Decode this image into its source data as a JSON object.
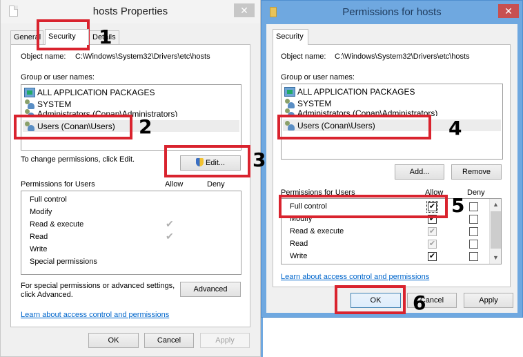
{
  "properties_window": {
    "title": "hosts Properties",
    "close_label": "✕",
    "tabs": [
      {
        "label": "General",
        "active": false
      },
      {
        "label": "Security",
        "active": true
      },
      {
        "label": "Details",
        "active": false
      }
    ],
    "object_name_label": "Object name:",
    "object_name_value": "C:\\Windows\\System32\\Drivers\\etc\\hosts",
    "group_label": "Group or user names:",
    "groups": [
      {
        "name": "ALL APPLICATION PACKAGES",
        "icon": "package-icon",
        "selected": false
      },
      {
        "name": "SYSTEM",
        "icon": "users-icon",
        "selected": false
      },
      {
        "name": "Administrators (Conan\\Administrators)",
        "icon": "users-icon",
        "selected": false
      },
      {
        "name": "Users (Conan\\Users)",
        "icon": "users-icon",
        "selected": true
      }
    ],
    "change_hint": "To change permissions, click Edit.",
    "edit_button": "Edit...",
    "permissions_label": "Permissions for Users",
    "allow_header": "Allow",
    "deny_header": "Deny",
    "permissions": [
      {
        "name": "Full control",
        "allow": false,
        "deny": false
      },
      {
        "name": "Modify",
        "allow": false,
        "deny": false
      },
      {
        "name": "Read & execute",
        "allow": true,
        "deny": false
      },
      {
        "name": "Read",
        "allow": true,
        "deny": false
      },
      {
        "name": "Write",
        "allow": false,
        "deny": false
      },
      {
        "name": "Special permissions",
        "allow": false,
        "deny": false
      }
    ],
    "advanced_hint_line1": "For special permissions or advanced settings,",
    "advanced_hint_line2": "click Advanced.",
    "advanced_button": "Advanced",
    "learn_link": "Learn about access control and permissions",
    "ok_button": "OK",
    "cancel_button": "Cancel",
    "apply_button": "Apply"
  },
  "permissions_window": {
    "title": "Permissions for hosts",
    "close_label": "✕",
    "tab_label": "Security",
    "object_name_label": "Object name:",
    "object_name_value": "C:\\Windows\\System32\\Drivers\\etc\\hosts",
    "group_label": "Group or user names:",
    "groups": [
      {
        "name": "ALL APPLICATION PACKAGES",
        "icon": "package-icon",
        "selected": false
      },
      {
        "name": "SYSTEM",
        "icon": "users-icon",
        "selected": false
      },
      {
        "name": "Administrators (Conan\\Administrators)",
        "icon": "users-icon",
        "selected": false
      },
      {
        "name": "Users (Conan\\Users)",
        "icon": "users-icon",
        "selected": true
      }
    ],
    "add_button": "Add...",
    "remove_button": "Remove",
    "permissions_label": "Permissions for Users",
    "allow_header": "Allow",
    "deny_header": "Deny",
    "permissions": [
      {
        "name": "Full control",
        "allow": "checked",
        "deny": false
      },
      {
        "name": "Modify",
        "allow": "checked",
        "deny": false
      },
      {
        "name": "Read & execute",
        "allow": "inherited",
        "deny": false
      },
      {
        "name": "Read",
        "allow": "inherited",
        "deny": false
      },
      {
        "name": "Write",
        "allow": "checked",
        "deny": false
      }
    ],
    "check_glyph": "✔",
    "learn_link": "Learn about access control and permissions",
    "ok_button": "OK",
    "cancel_button": "Cancel",
    "apply_button": "Apply"
  },
  "annotations": {
    "color": "#d9232e",
    "steps": [
      "1",
      "2",
      "3",
      "4",
      "5",
      "6"
    ]
  }
}
